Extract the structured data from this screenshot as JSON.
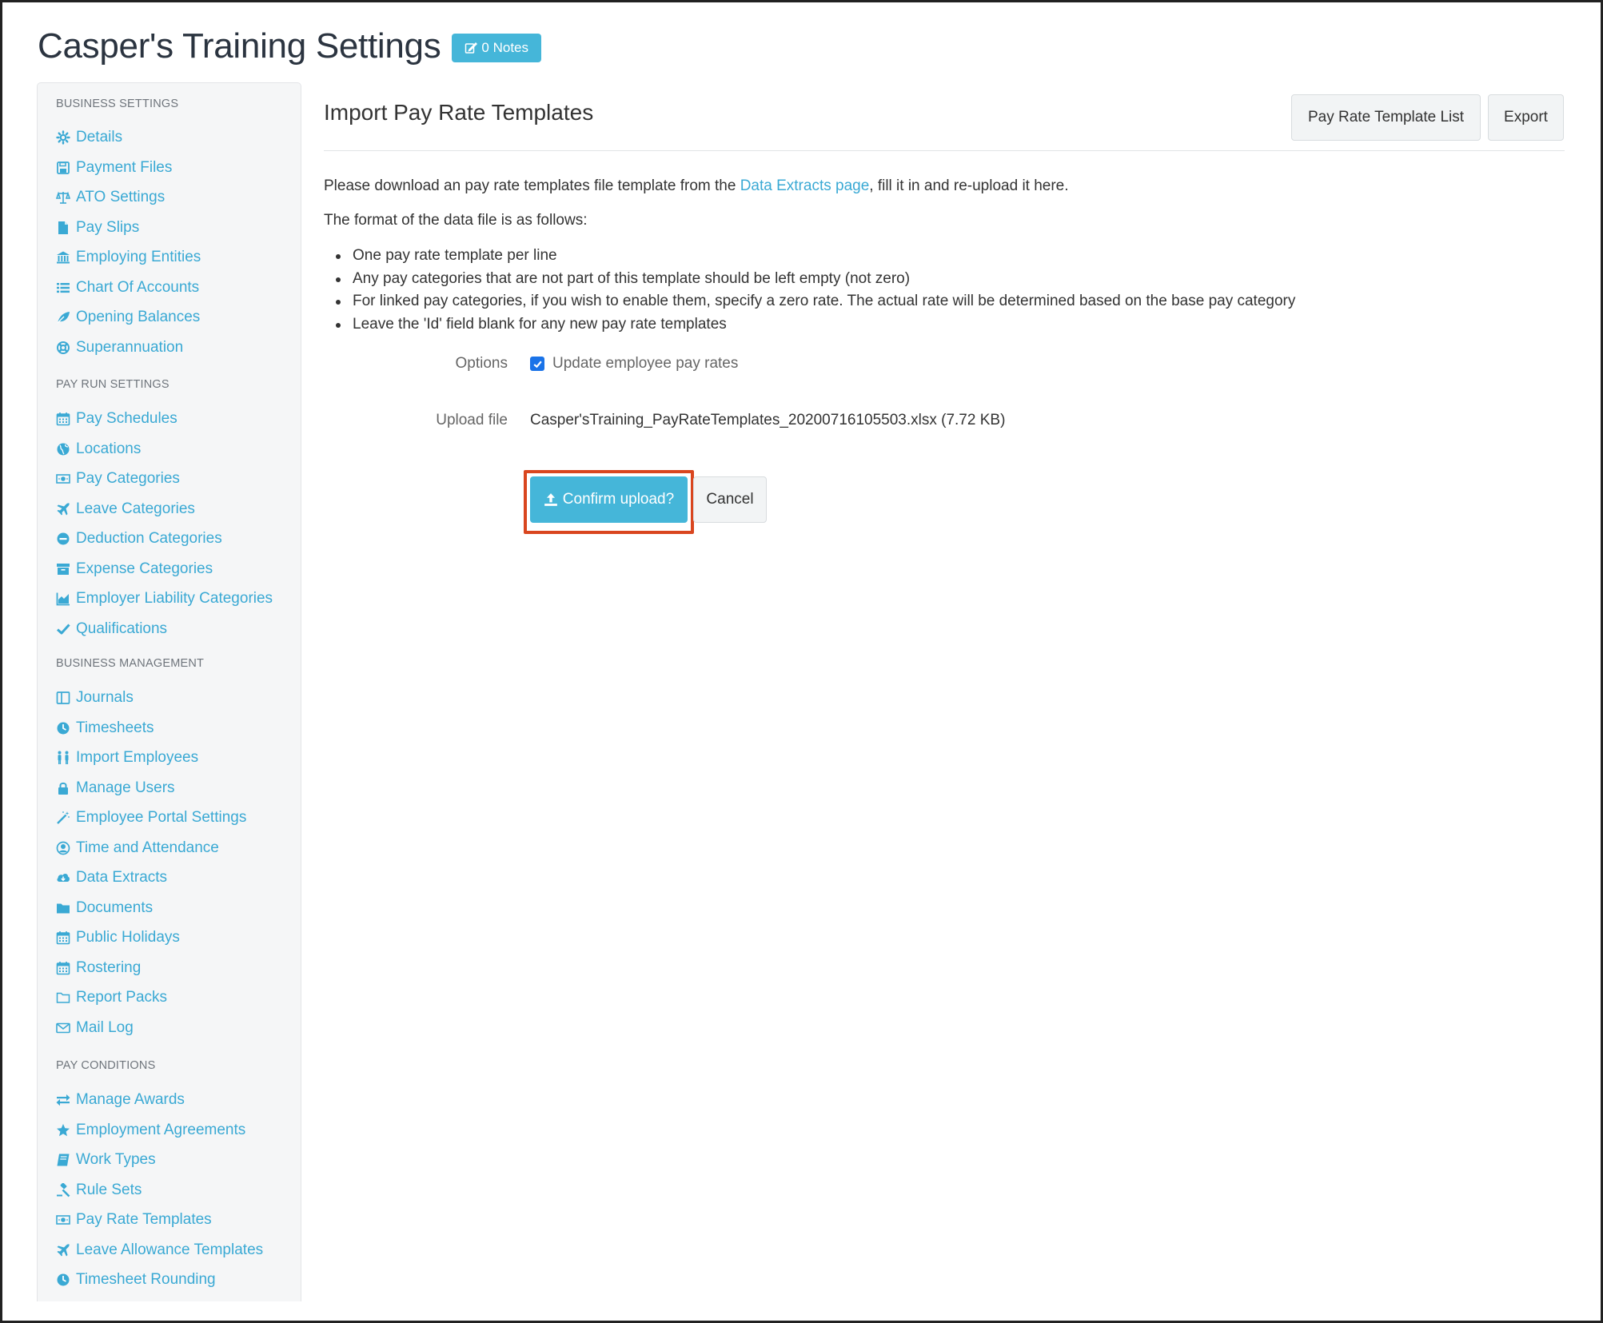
{
  "header": {
    "title": "Casper's Training Settings",
    "notes_label": "0 Notes"
  },
  "sidebar": {
    "sections": [
      {
        "heading": "BUSINESS SETTINGS",
        "items": [
          {
            "label": "Details",
            "icon": "gear-icon"
          },
          {
            "label": "Payment Files",
            "icon": "floppy-disk-icon"
          },
          {
            "label": "ATO Settings",
            "icon": "scales-icon"
          },
          {
            "label": "Pay Slips",
            "icon": "file-icon"
          },
          {
            "label": "Employing Entities",
            "icon": "bank-icon"
          },
          {
            "label": "Chart Of Accounts",
            "icon": "list-icon"
          },
          {
            "label": "Opening Balances",
            "icon": "leaf-icon"
          },
          {
            "label": "Superannuation",
            "icon": "lifebuoy-icon"
          }
        ]
      },
      {
        "heading": "PAY RUN SETTINGS",
        "items": [
          {
            "label": "Pay Schedules",
            "icon": "calendar-icon"
          },
          {
            "label": "Locations",
            "icon": "globe-icon"
          },
          {
            "label": "Pay Categories",
            "icon": "money-icon"
          },
          {
            "label": "Leave Categories",
            "icon": "plane-icon"
          },
          {
            "label": "Deduction Categories",
            "icon": "minus-circle-icon"
          },
          {
            "label": "Expense Categories",
            "icon": "archive-icon"
          },
          {
            "label": "Employer Liability Categories",
            "icon": "area-chart-icon"
          },
          {
            "label": "Qualifications",
            "icon": "check-icon"
          }
        ]
      },
      {
        "heading": "BUSINESS MANAGEMENT",
        "items": [
          {
            "label": "Journals",
            "icon": "columns-icon"
          },
          {
            "label": "Timesheets",
            "icon": "clock-icon"
          },
          {
            "label": "Import Employees",
            "icon": "people-icon"
          },
          {
            "label": "Manage Users",
            "icon": "lock-icon"
          },
          {
            "label": "Employee Portal Settings",
            "icon": "wand-icon"
          },
          {
            "label": "Time and Attendance",
            "icon": "user-circle-icon"
          },
          {
            "label": "Data Extracts",
            "icon": "cloud-download-icon"
          },
          {
            "label": "Documents",
            "icon": "folder-icon"
          },
          {
            "label": "Public Holidays",
            "icon": "calendar-icon"
          },
          {
            "label": "Rostering",
            "icon": "calendar-icon"
          },
          {
            "label": "Report Packs",
            "icon": "folder-open-icon"
          },
          {
            "label": "Mail Log",
            "icon": "envelope-icon"
          }
        ]
      },
      {
        "heading": "PAY CONDITIONS",
        "items": [
          {
            "label": "Manage Awards",
            "icon": "exchange-icon"
          },
          {
            "label": "Employment Agreements",
            "icon": "star-icon"
          },
          {
            "label": "Work Types",
            "icon": "book-icon"
          },
          {
            "label": "Rule Sets",
            "icon": "gavel-icon"
          },
          {
            "label": "Pay Rate Templates",
            "icon": "money-icon"
          },
          {
            "label": "Leave Allowance Templates",
            "icon": "plane-icon"
          },
          {
            "label": "Timesheet Rounding",
            "icon": "clock-icon"
          }
        ]
      }
    ]
  },
  "main": {
    "title": "Import Pay Rate Templates",
    "list_button": "Pay Rate Template List",
    "export_button": "Export",
    "intro_before": "Please download an pay rate templates file template from the ",
    "intro_link": "Data Extracts page",
    "intro_after": ", fill it in and re-upload it here.",
    "format_intro": "The format of the data file is as follows:",
    "rules": [
      "One pay rate template per line",
      "Any pay categories that are not part of this template should be left empty (not zero)",
      "For linked pay categories, if you wish to enable them, specify a zero rate. The actual rate will be determined based on the base pay category",
      "Leave the 'Id' field blank for any new pay rate templates"
    ],
    "options_label": "Options",
    "update_rates_label": "Update employee pay rates",
    "upload_label": "Upload file",
    "file_name": "Casper'sTraining_PayRateTemplates_20200716105503.xlsx (7.72 KB)",
    "confirm_button": "Confirm upload?",
    "cancel_button": "Cancel"
  },
  "colors": {
    "accent": "#45b6d9",
    "link": "#3aa9d4",
    "highlight": "#d9461f"
  }
}
